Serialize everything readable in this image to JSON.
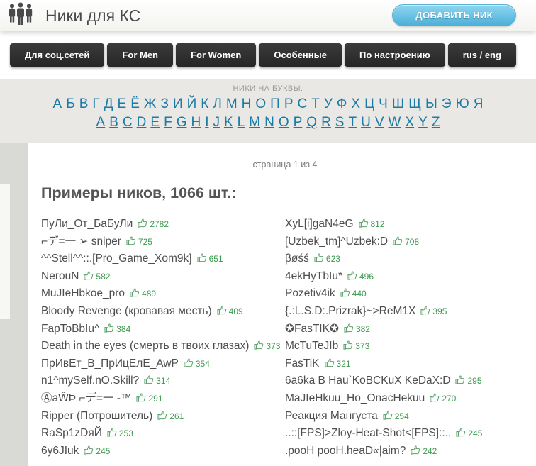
{
  "header": {
    "title": "Ники для КС",
    "add_button": "ДОБАВИТЬ НИК"
  },
  "nav": {
    "items": [
      "Для соц.сетей",
      "For Men",
      "For Women",
      "Особенные",
      "По настроению",
      "rus / eng"
    ]
  },
  "alphabet": {
    "label": "НИКИ НА БУКВЫ:",
    "cyrillic": [
      "А",
      "Б",
      "В",
      "Г",
      "Д",
      "Е",
      "Ё",
      "Ж",
      "З",
      "И",
      "Й",
      "К",
      "Л",
      "М",
      "Н",
      "О",
      "П",
      "Р",
      "С",
      "Т",
      "У",
      "Ф",
      "Х",
      "Ц",
      "Ч",
      "Ш",
      "Щ",
      "Ы",
      "Э",
      "Ю",
      "Я"
    ],
    "latin": [
      "A",
      "B",
      "C",
      "D",
      "E",
      "F",
      "G",
      "H",
      "I",
      "J",
      "K",
      "L",
      "M",
      "N",
      "O",
      "P",
      "Q",
      "R",
      "S",
      "T",
      "U",
      "V",
      "W",
      "X",
      "Y",
      "Z"
    ]
  },
  "main": {
    "pagination": "--- страница 1 из 4 ---",
    "heading": "Примеры ников, 1066 шт.:",
    "left_column": [
      {
        "name": "ПуЛи_От_БаБуЛи",
        "likes": "2782"
      },
      {
        "name": "⌐デ=一 ➢ sniper",
        "likes": "725"
      },
      {
        "name": "^^Stell^^::.[Pro_Game_Xom9k]",
        "likes": "651"
      },
      {
        "name": "NerouN",
        "likes": "582"
      },
      {
        "name": "MuJIeHbkoe_pro",
        "likes": "489"
      },
      {
        "name": "Bloody Revenge (кровавая месть)",
        "likes": "409"
      },
      {
        "name": "FapToBbIu^",
        "likes": "384"
      },
      {
        "name": "Death in the eyes (смерть в твоих глазах)",
        "likes": "373"
      },
      {
        "name": "ПрИвЕт_В_ПрИцЕлЕ_AwP",
        "likes": "354"
      },
      {
        "name": "n1^mySelf.nO.Skill?",
        "likes": "314"
      },
      {
        "name": "ⒶaŴÞ ⌐デ=一 -™",
        "likes": "291"
      },
      {
        "name": "Ripper (Потрошитель)",
        "likes": "261"
      },
      {
        "name": "RaSp1zDяЙ",
        "likes": "253"
      },
      {
        "name": "6y6JIuk",
        "likes": "245"
      }
    ],
    "right_column": [
      {
        "name": "XyL[i]gaN4eG",
        "likes": "812"
      },
      {
        "name": "[Uzbek_tm]^Uzbek:D",
        "likes": "708"
      },
      {
        "name": "βøśś",
        "likes": "623"
      },
      {
        "name": "4ekHyTbIu*",
        "likes": "496"
      },
      {
        "name": "Pozetiv4ik",
        "likes": "440"
      },
      {
        "name": "{.:L.S.D:.Prizrak}~>ReM1X",
        "likes": "395"
      },
      {
        "name": "✪FasTIK✪",
        "likes": "382"
      },
      {
        "name": "McTuTeJIb",
        "likes": "373"
      },
      {
        "name": "FasTiK",
        "likes": "321"
      },
      {
        "name": "6a6ka B Hau`KoBCKuX KeDaX:D",
        "likes": "295"
      },
      {
        "name": "MaJIeHkuu_Ho_OnacHekuu",
        "likes": "270"
      },
      {
        "name": "Реакция Мангуста",
        "likes": "254"
      },
      {
        "name": "..::[FPS]>Zloy-Heat-Shot<[FPS]::..",
        "likes": "245"
      },
      {
        "name": ".pooH pooH.heaD«|aim?",
        "likes": "242"
      }
    ]
  },
  "colors": {
    "accent_blue": "#4cb0d8",
    "link_teal": "#1b7aa6",
    "like_green": "#3d9a50",
    "button_dark": "#2c2c2c"
  }
}
